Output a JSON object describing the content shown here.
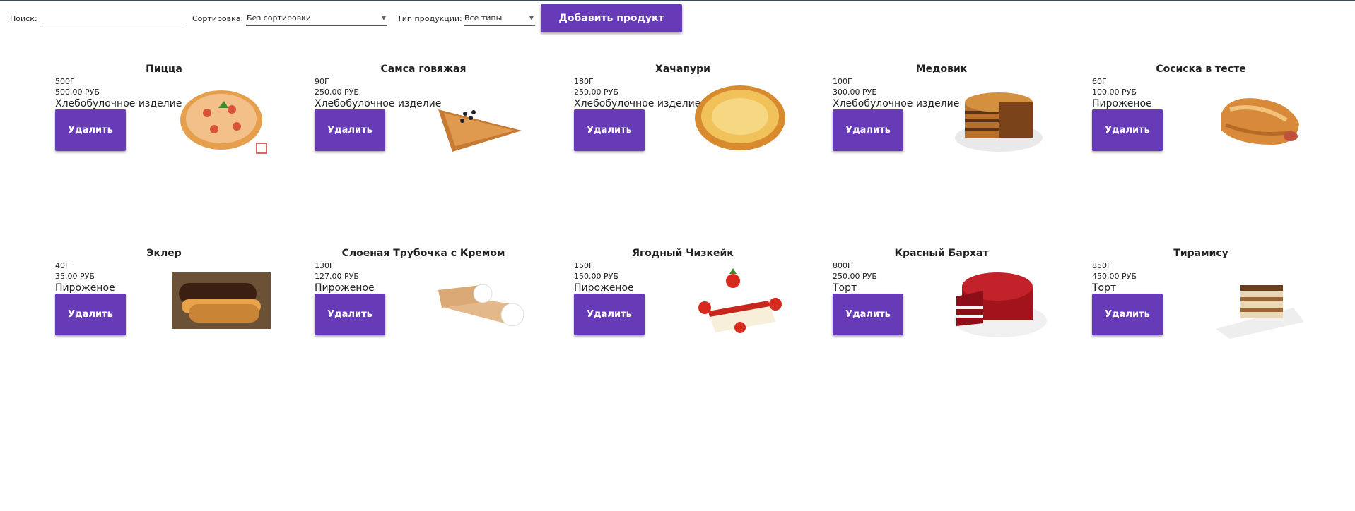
{
  "toolbar": {
    "search_label": "Поиск:",
    "search_value": "",
    "sort_label": "Сортировка:",
    "sort_value": "Без сортировки",
    "type_label": "Тип продукции:",
    "type_value": "Все типы",
    "add_button": "Добавить продукт"
  },
  "delete_label": "Удалить",
  "products": [
    {
      "name": "Пицца",
      "weight": "500Г",
      "price": "500.00 РУБ",
      "type": "Хлебобулочное изделие",
      "icon": "pizza-image"
    },
    {
      "name": "Самса говяжая",
      "weight": "90Г",
      "price": "250.00 РУБ",
      "type": "Хлебобулочное изделие",
      "icon": "samsa-image"
    },
    {
      "name": "Хачапури",
      "weight": "180Г",
      "price": "250.00 РУБ",
      "type": "Хлебобулочное изделие",
      "icon": "khachapuri-image"
    },
    {
      "name": "Медовик",
      "weight": "100Г",
      "price": "300.00 РУБ",
      "type": "Хлебобулочное изделие",
      "icon": "honey-cake-image"
    },
    {
      "name": "Сосиска в тесте",
      "weight": "60Г",
      "price": "100.00 РУБ",
      "type": "Пироженое",
      "icon": "sausage-roll-image"
    },
    {
      "name": "Эклер",
      "weight": "40Г",
      "price": "35.00 РУБ",
      "type": "Пироженое",
      "icon": "eclair-image"
    },
    {
      "name": "Слоеная Трубочка с Кремом",
      "weight": "130Г",
      "price": "127.00 РУБ",
      "type": "Пироженое",
      "icon": "cream-horn-image"
    },
    {
      "name": "Ягодный Чизкейк",
      "weight": "150Г",
      "price": "150.00 РУБ",
      "type": "Пироженое",
      "icon": "cheesecake-image"
    },
    {
      "name": "Красный Бархат",
      "weight": "800Г",
      "price": "250.00 РУБ",
      "type": "Торт",
      "icon": "red-velvet-image"
    },
    {
      "name": "Тирамису",
      "weight": "850Г",
      "price": "450.00 РУБ",
      "type": "Торт",
      "icon": "tiramisu-image"
    }
  ],
  "colors": {
    "accent": "#673ab7",
    "text": "#222222"
  }
}
